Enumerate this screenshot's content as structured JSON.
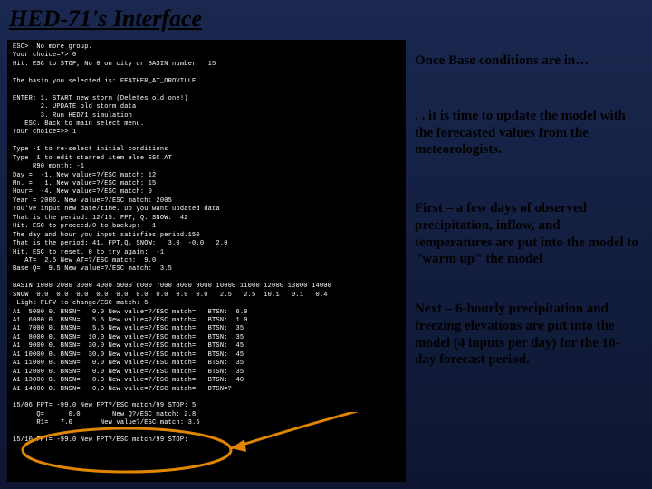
{
  "title": "HED-71's Interface",
  "terminal_text": "ESC>  No more group.\nYour choice=?> 0\nHit. ESC to STOP, No 0 on city or BASIN number   15\n\nThe basin you selected is: FEATHER_AT_OROVILLE\n\nENTER: 1. START new storm (Deletes old one!)\n       2. UPDATE old storm data\n       3. Run HED71 simulation\n   ESC. Back to main select menu.\nYour choice=>> 1\n\nType -1 to re-select initial conditions\nType  1 to edit starred item else ESC AT\n     R90 month: -1\nDay =  -1. New value=?/ESC match: 12\nMn. =   1. New value=?/ESC match: 15\nHour=  -4. New value=?/ESC match: 0\nYear = 2006. New value=?/ESC match: 2005\nYou've input new date/time. Do you want updated data\nThat is the period: 12/15. FPT, Q. SNOW:  42\nHit. ESC to proceed/0 to backup:  -1\nThe day and hour you input satisfies period.150\nThat is the period: 41. FPT,Q. SNOW:   3.0  -0.0   2.0\nHit. ESC to reset. 0 to try again:  -1\n   AT=  2.5 New AT=?/ESC match:  9.0\nBase Q=  9.5 New value=?/ESC match:  3.5\n\nBASIN 1000 2000 3000 4000 5000 6000 7000 8000 9000 10000 11000 12000 13000 14000\nSNOW  0.0  0.0  0.0  0.0  0.0  0.0  0.0  0.0  0.0   2.5   2.5  10.1   0.1   0.4\n Light FLFV to change/ESC match: 5\nA1  5000 0. BNSN=   0.0 New value=?/ESC match=   BTSN:  6.0\nA1  6000 0. BNSN=   5.5 New value=?/ESC match=   BTSN:  1.0\nA1  7000 0. BNSN=   5.5 New value=?/ESC match=   BTSN:  35\nA1  8000 0. BNSN=  10.0 New value=?/ESC match=   BTSN:  35\nA1  9000 0. BNSN=  30.0 New value=?/ESC match=   BTSN:  45\nA1 10000 0. BNSN=  30.0 New value=?/ESC match=   BTSN:  45\nA1 11000 0. BNSN=   0.0 New value=?/ESC match=   BTSN:  35\nA1 12000 0. BNSN=   0.0 New value=?/ESC match=   BTSN:  35\nA1 13000 0. BNSN=   8.0 New value=?/ESC match=   BTSN:  40\nA1 14000 0. BNSN=   0.0 New value=?/ESC match=   BTSN=?\n\n15/06 FPT= -99.0 New FPT?/ESC match/99 STOP: 5\n      Q=      0.0        New Q?/ESC match: 2.8\n      R1=   7.0       New value?/ESC match: 3.5\n\n15/10 FPT= -99.0 New FPT?/ESC match/99 STOP:",
  "notes": [
    "Once Base conditions are in…",
    ". . it is time to update the model with the forecasted values from the meteorologists.",
    "First – a few days of observed precipitation, inflow, and temperatures are put into the model to \"warm up\" the model",
    "Next – 6-hourly precipitation and freezing elevations are put into the model (4 inputs per day) for the 10-day forecast period."
  ]
}
